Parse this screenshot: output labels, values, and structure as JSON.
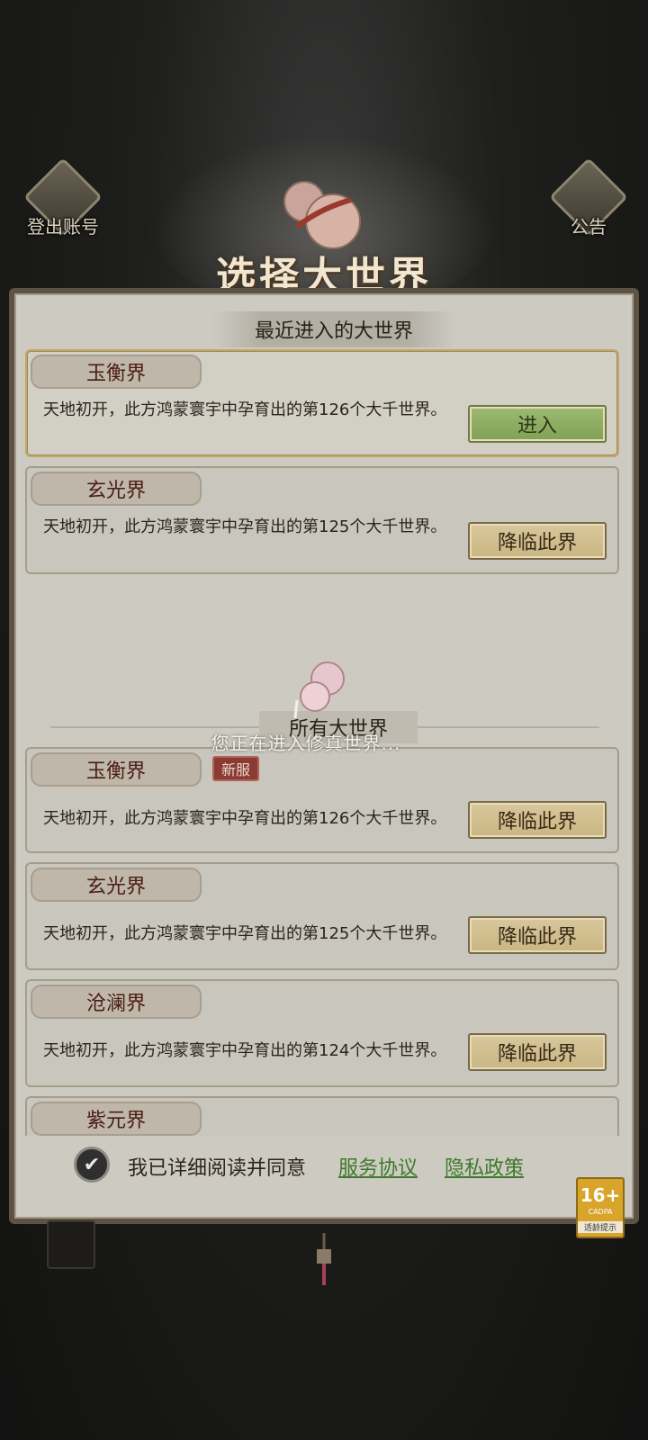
{
  "header": {
    "logout_label": "登出账号",
    "notice_label": "公告",
    "title": "选择大世界"
  },
  "recent": {
    "title": "最近进入的大世界",
    "servers": [
      {
        "name": "玉衡界",
        "desc": "天地初开，此方鸿蒙寰宇中孕育出的第126个大千世界。",
        "action": "进入"
      },
      {
        "name": "玄光界",
        "desc": "天地初开，此方鸿蒙寰宇中孕育出的第125个大千世界。",
        "action": "降临此界"
      }
    ]
  },
  "all": {
    "title": "所有大世界",
    "servers": [
      {
        "name": "玉衡界",
        "badge": "新服",
        "desc": "天地初开，此方鸿蒙寰宇中孕育出的第126个大千世界。",
        "action": "降临此界"
      },
      {
        "name": "玄光界",
        "desc": "天地初开，此方鸿蒙寰宇中孕育出的第125个大千世界。",
        "action": "降临此界"
      },
      {
        "name": "沧澜界",
        "desc": "天地初开，此方鸿蒙寰宇中孕育出的第124个大千世界。",
        "action": "降临此界"
      },
      {
        "name": "紫元界"
      }
    ]
  },
  "loading": {
    "text": "您正在进入修真世界..."
  },
  "agreement": {
    "text": "我已详细阅读并同意",
    "tos": "服务协议",
    "privacy": "隐私政策",
    "checked": true
  },
  "age_rating": {
    "label": "16+",
    "org": "CADPA",
    "tip": "适龄提示"
  },
  "colors": {
    "accent_green": "#7fa155",
    "gold_button": "#c9b682",
    "new_badge": "#8a3b33"
  }
}
